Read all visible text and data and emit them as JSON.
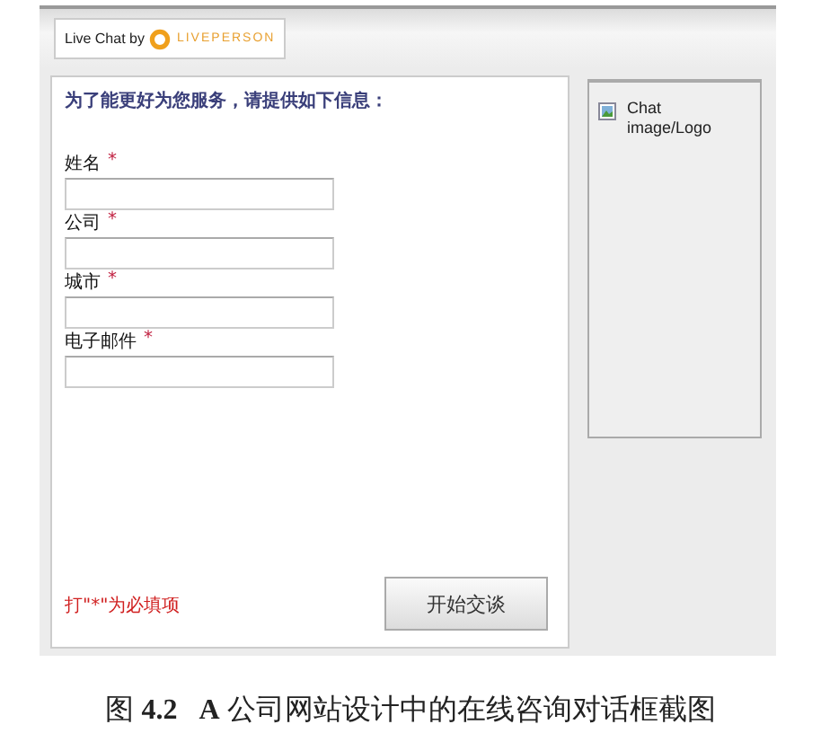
{
  "header": {
    "logo_prefix": "Live Chat by",
    "logo_brand": "LIVEPERSON"
  },
  "form": {
    "title": "为了能更好为您服务，请提供如下信息：",
    "fields": [
      {
        "label": "姓名",
        "required": true
      },
      {
        "label": "公司",
        "required": true
      },
      {
        "label": "城市",
        "required": true
      },
      {
        "label": "电子邮件",
        "required": true
      }
    ],
    "required_marker": "*",
    "note": "打\"*\"为必填项",
    "submit": "开始交谈"
  },
  "side_panel": {
    "image_alt": "Chat image/Logo"
  },
  "caption": "图 **4.2**   **A** 公司网站设计中的在线咨询对话框截图"
}
